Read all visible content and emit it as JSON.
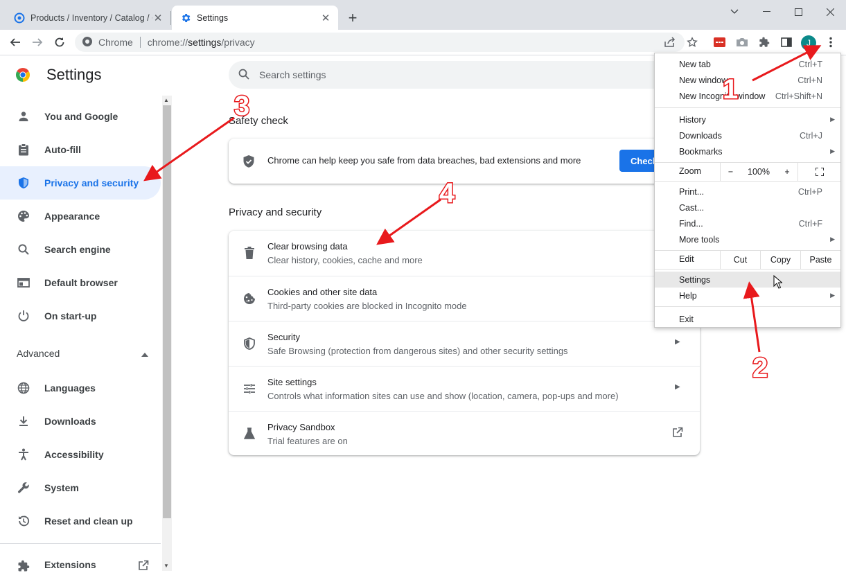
{
  "tabs": [
    {
      "title": "Products / Inventory / Catalog / C",
      "active": false
    },
    {
      "title": "Settings",
      "active": true
    }
  ],
  "omnibox": {
    "site": "Chrome",
    "url_prefix": "chrome://",
    "url_path": "settings",
    "url_suffix": "/privacy"
  },
  "profile_initial": "J",
  "page": {
    "title": "Settings",
    "search_placeholder": "Search settings"
  },
  "sidebar": {
    "items": [
      {
        "label": "You and Google",
        "icon": "person-icon"
      },
      {
        "label": "Auto-fill",
        "icon": "clipboard-icon"
      },
      {
        "label": "Privacy and security",
        "icon": "shield-icon",
        "selected": true
      },
      {
        "label": "Appearance",
        "icon": "palette-icon"
      },
      {
        "label": "Search engine",
        "icon": "search-icon"
      },
      {
        "label": "Default browser",
        "icon": "browser-icon"
      },
      {
        "label": "On start-up",
        "icon": "power-icon"
      }
    ],
    "advanced_label": "Advanced",
    "advanced_items": [
      {
        "label": "Languages",
        "icon": "globe-icon"
      },
      {
        "label": "Downloads",
        "icon": "download-icon"
      },
      {
        "label": "Accessibility",
        "icon": "accessibility-icon"
      },
      {
        "label": "System",
        "icon": "wrench-icon"
      },
      {
        "label": "Reset and clean up",
        "icon": "history-icon"
      }
    ],
    "extensions_label": "Extensions"
  },
  "safety_check": {
    "heading": "Safety check",
    "text": "Chrome can help keep you safe from data breaches, bad extensions and more",
    "button": "Check"
  },
  "privacy": {
    "heading": "Privacy and security",
    "rows": [
      {
        "title": "Clear browsing data",
        "subtitle": "Clear history, cookies, cache and more",
        "icon": "trash-icon"
      },
      {
        "title": "Cookies and other site data",
        "subtitle": "Third-party cookies are blocked in Incognito mode",
        "icon": "cookie-icon"
      },
      {
        "title": "Security",
        "subtitle": "Safe Browsing (protection from dangerous sites) and other security settings",
        "icon": "shield-icon"
      },
      {
        "title": "Site settings",
        "subtitle": "Controls what information sites can use and show (location, camera, pop-ups and more)",
        "icon": "sliders-icon"
      },
      {
        "title": "Privacy Sandbox",
        "subtitle": "Trial features are on",
        "icon": "flask-icon"
      }
    ]
  },
  "menu": {
    "new_tab": {
      "label": "New tab",
      "shortcut": "Ctrl+T"
    },
    "new_window": {
      "label": "New window",
      "shortcut": "Ctrl+N"
    },
    "new_incognito": {
      "label": "New Incognito window",
      "shortcut": "Ctrl+Shift+N"
    },
    "history": {
      "label": "History"
    },
    "downloads": {
      "label": "Downloads",
      "shortcut": "Ctrl+J"
    },
    "bookmarks": {
      "label": "Bookmarks"
    },
    "zoom": {
      "label": "Zoom",
      "minus": "−",
      "value": "100%",
      "plus": "+"
    },
    "print": {
      "label": "Print...",
      "shortcut": "Ctrl+P"
    },
    "cast": {
      "label": "Cast..."
    },
    "find": {
      "label": "Find...",
      "shortcut": "Ctrl+F"
    },
    "more_tools": {
      "label": "More tools"
    },
    "edit": {
      "label": "Edit",
      "cut": "Cut",
      "copy": "Copy",
      "paste": "Paste"
    },
    "settings": {
      "label": "Settings"
    },
    "help": {
      "label": "Help"
    },
    "exit": {
      "label": "Exit"
    }
  },
  "annotations": [
    "1",
    "2",
    "3",
    "4"
  ],
  "colors": {
    "accent": "#1a73e8",
    "selected_bg": "#e8f0fe",
    "annotation": "#e8191c"
  }
}
